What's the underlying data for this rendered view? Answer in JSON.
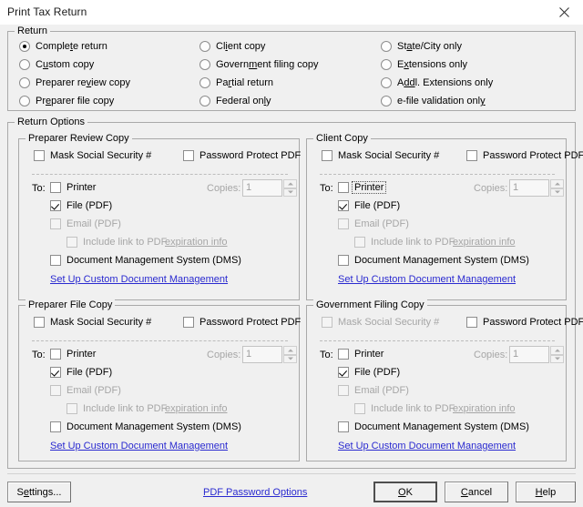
{
  "window": {
    "title": "Print Tax Return",
    "close_icon": "close-icon"
  },
  "return_group": {
    "title": "Return",
    "options": [
      {
        "label": "Complete return",
        "accel": "t",
        "selected": true
      },
      {
        "label": "Custom copy",
        "accel": "u",
        "selected": false
      },
      {
        "label": "Preparer review copy",
        "accel": "v",
        "selected": false
      },
      {
        "label": "Preparer file copy",
        "accel": "e",
        "selected": false
      },
      {
        "label": "Client copy",
        "accel": "i",
        "selected": false
      },
      {
        "label": "Government filing copy",
        "accel": "m",
        "selected": false
      },
      {
        "label": "Partial return",
        "accel": "r",
        "selected": false
      },
      {
        "label": "Federal only",
        "accel": "l",
        "selected": false
      },
      {
        "label": "State/City only",
        "accel": "a",
        "selected": false
      },
      {
        "label": "Extensions only",
        "accel": "x",
        "selected": false
      },
      {
        "label": "Addl. Extensions only",
        "accel": "dd",
        "selected": false
      },
      {
        "label": "e-file validation only",
        "accel": "y",
        "selected": false
      }
    ]
  },
  "return_options": {
    "title": "Return Options",
    "common": {
      "mask_ssn_label": "Mask Social Security #",
      "password_protect_label": "Password Protect PDF",
      "to_label": "To:",
      "printer_label": "Printer",
      "file_label": "File (PDF)",
      "email_label": "Email (PDF)",
      "include_link_label": "Include link to PDF",
      "expiration_info_label": "expiration info",
      "dms_label": "Document Management System (DMS)",
      "setup_link_label": "Set Up Custom Document Management",
      "copies_label": "Copies:",
      "copies_value": "1"
    },
    "panels": [
      {
        "id": "prc",
        "title": "Preparer Review Copy",
        "mask_ssn_checked": false,
        "mask_ssn_disabled": false,
        "password_protect_checked": false,
        "printer_checked": false,
        "printer_focused": false,
        "file_checked": true,
        "email_checked": false,
        "include_link_checked": false,
        "dms_checked": false
      },
      {
        "id": "cc",
        "title": "Client Copy",
        "mask_ssn_checked": false,
        "mask_ssn_disabled": false,
        "password_protect_checked": false,
        "printer_checked": false,
        "printer_focused": true,
        "file_checked": true,
        "email_checked": false,
        "include_link_checked": false,
        "dms_checked": false
      },
      {
        "id": "pfc",
        "title": "Preparer File Copy",
        "mask_ssn_checked": false,
        "mask_ssn_disabled": false,
        "password_protect_checked": false,
        "printer_checked": false,
        "printer_focused": false,
        "file_checked": true,
        "email_checked": false,
        "include_link_checked": false,
        "dms_checked": false
      },
      {
        "id": "gfc",
        "title": "Government Filing Copy",
        "mask_ssn_checked": false,
        "mask_ssn_disabled": true,
        "password_protect_checked": false,
        "printer_checked": false,
        "printer_focused": false,
        "file_checked": true,
        "email_checked": false,
        "include_link_checked": false,
        "dms_checked": false
      }
    ]
  },
  "footer": {
    "settings_label": "Settings...",
    "settings_accel": "e",
    "pdf_password_options_label": "PDF Password Options",
    "ok_label": "OK",
    "ok_accel": "O",
    "cancel_label": "Cancel",
    "cancel_accel": "C",
    "help_label": "Help",
    "help_accel": "H"
  }
}
